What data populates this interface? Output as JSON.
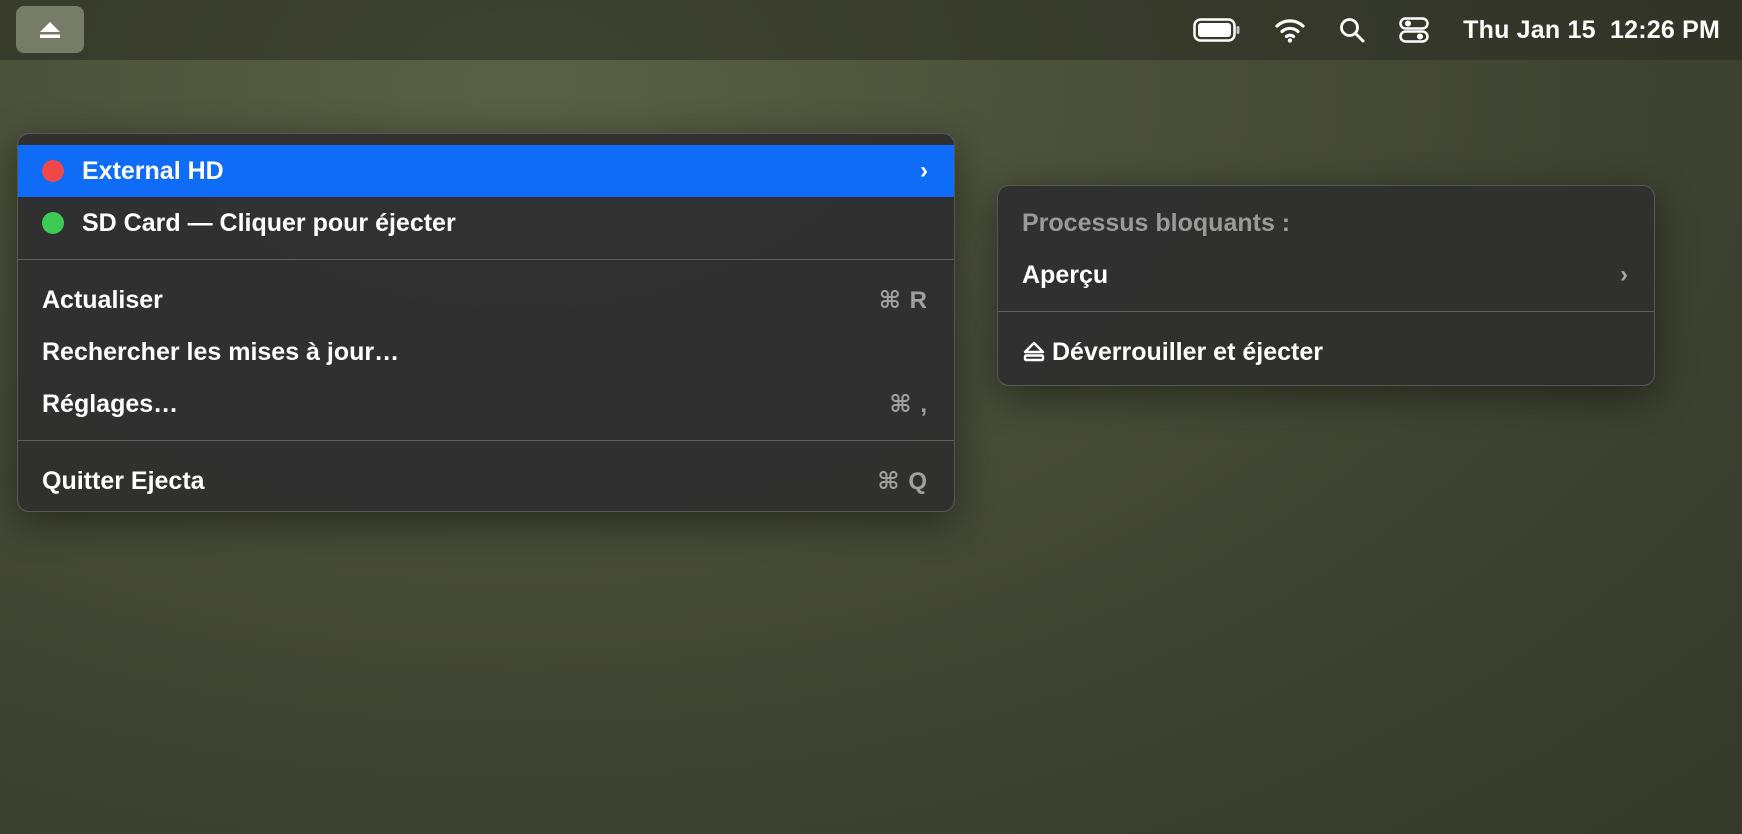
{
  "menubar": {
    "eject_icon": "eject-icon",
    "status_icons": [
      "battery-icon",
      "wifi-icon",
      "search-icon",
      "control-center-icon"
    ],
    "clock": "Thu Jan 15  12:26 PM"
  },
  "main_menu": {
    "volumes": [
      {
        "name": "External HD",
        "status_color": "#f04848",
        "has_submenu": true,
        "highlighted": true
      },
      {
        "name": "SD Card — Cliquer pour éjecter",
        "status_color": "#3ccb55",
        "has_submenu": false,
        "highlighted": false
      }
    ],
    "actions": [
      {
        "label": "Actualiser",
        "shortcut": "⌘ R"
      },
      {
        "label": "Rechercher les mises à jour…",
        "shortcut": ""
      },
      {
        "label": "Réglages…",
        "shortcut": "⌘ ,"
      }
    ],
    "quit": {
      "label": "Quitter Ejecta",
      "shortcut": "⌘ Q"
    }
  },
  "sub_menu": {
    "header": "Processus bloquants :",
    "process": {
      "label": "Aperçu",
      "has_submenu": true
    },
    "unlock_eject": {
      "label": "Déverrouiller et éjecter",
      "icon": "eject-icon"
    }
  },
  "colors": {
    "highlight": "#0f6cf7",
    "menu_bg": "#303030"
  }
}
